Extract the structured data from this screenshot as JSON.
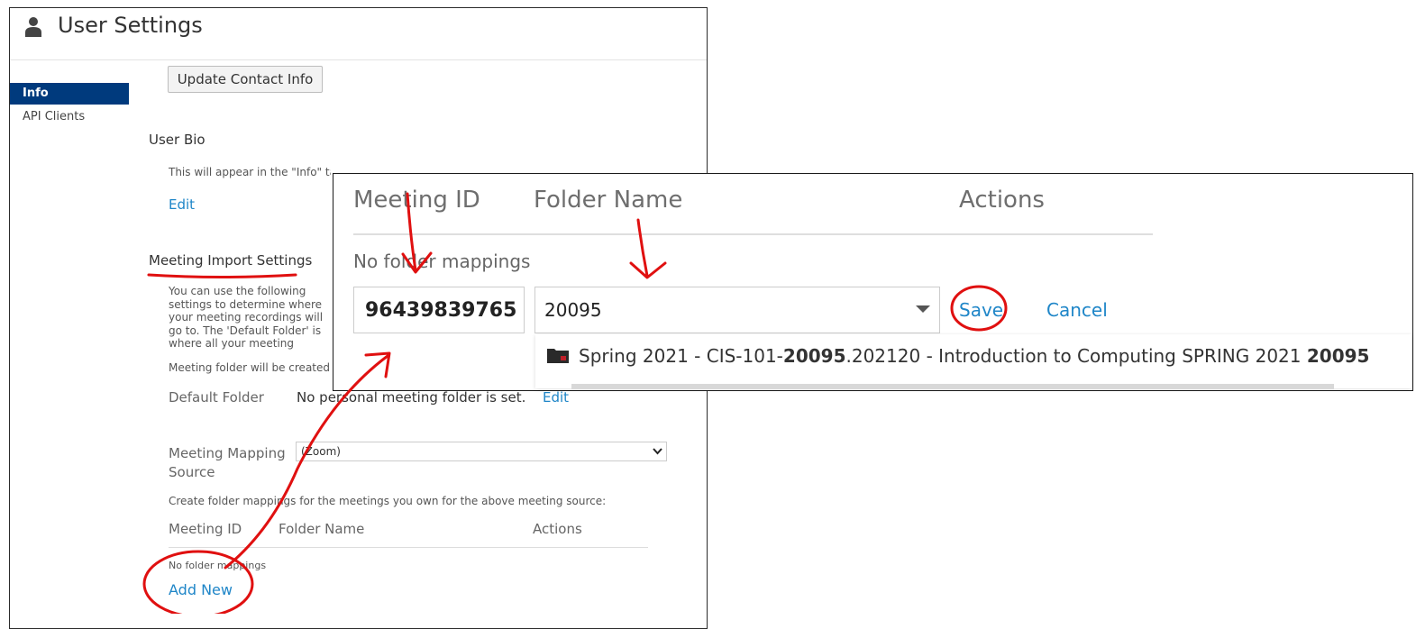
{
  "header": {
    "title": "User Settings",
    "icon": "user-icon"
  },
  "sidebar": {
    "items": [
      {
        "label": "Info",
        "active": true
      },
      {
        "label": "API Clients",
        "active": false
      }
    ]
  },
  "contact": {
    "update_button": "Update Contact Info"
  },
  "bio": {
    "title": "User Bio",
    "description": "This will appear in the \"Info\" tab of any session created by this user.",
    "edit_label": "Edit"
  },
  "import": {
    "title": "Meeting Import Settings",
    "description": "You can use the following settings to determine where your meeting recordings will go to. The 'Default Folder' is where all your meeting recordings will go unless you map a meeting to get imported to a specific folder. You can set up these mappings in the folder mapping table below.",
    "folder_note": "Meeting folder will be created under the Default Folder.",
    "default_folder_label": "Default Folder",
    "default_folder_value": "No personal meeting folder is set.",
    "default_folder_edit": "Edit",
    "source_label": "Meeting Mapping Source",
    "source_selected": "(Zoom)",
    "create_note": "Create folder mappings for the meetings you own for the above meeting source:",
    "table": {
      "col_meeting": "Meeting ID",
      "col_folder": "Folder Name",
      "col_actions": "Actions",
      "empty": "No folder mappings"
    },
    "add_new": "Add New"
  },
  "zoomed": {
    "col_meeting": "Meeting ID",
    "col_folder": "Folder Name",
    "col_actions": "Actions",
    "empty": "No folder mappings",
    "meeting_id_value": "96439839765",
    "folder_value": "20095",
    "save_label": "Save",
    "cancel_label": "Cancel",
    "dropdown_item": {
      "pre": "Spring 2021 - CIS-101-",
      "bold1": "20095",
      "mid": ".202120 - Introduction to Computing SPRING 2021 ",
      "bold2": "20095"
    }
  },
  "colors": {
    "nav_active": "#003a7d",
    "link": "#1f86c8",
    "annotation": "#e01010"
  }
}
